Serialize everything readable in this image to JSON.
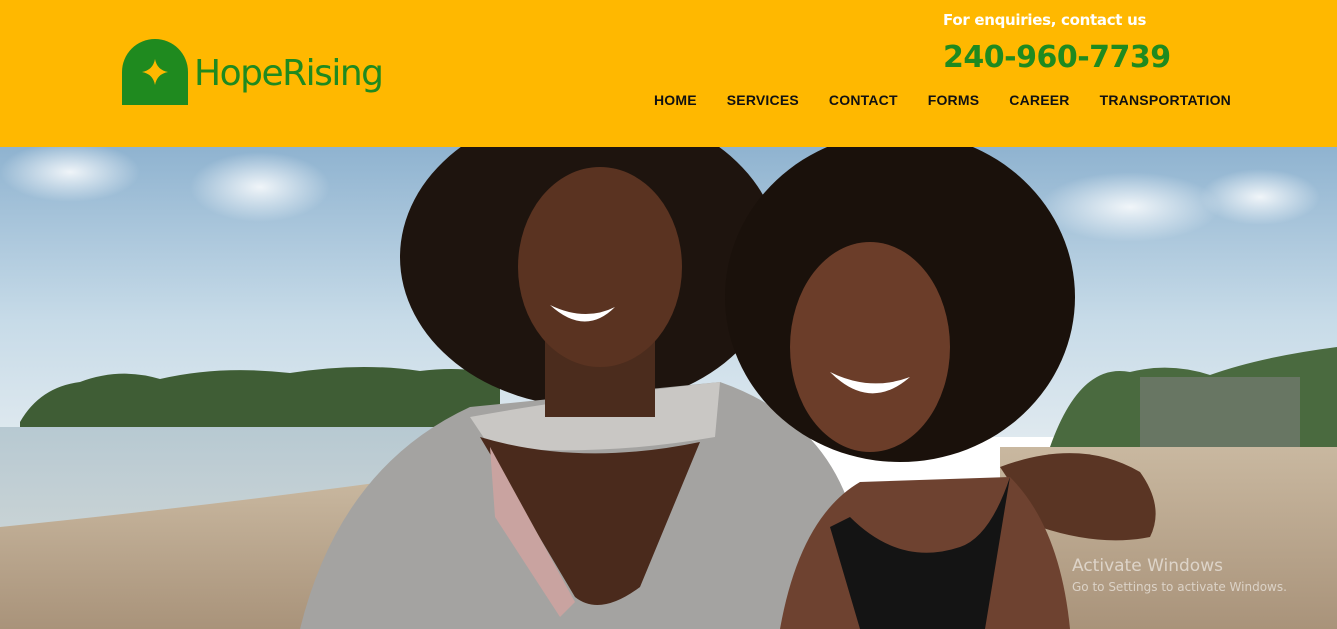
{
  "brand": {
    "name": "HopeRising",
    "color": "#1f8a1f",
    "header_bg": "#ffb800"
  },
  "contact": {
    "enquiry_label": "For enquiries, contact us",
    "phone": "240-960-7739"
  },
  "nav": {
    "items": [
      {
        "label": "HOME"
      },
      {
        "label": "SERVICES"
      },
      {
        "label": "CONTACT"
      },
      {
        "label": "FORMS"
      },
      {
        "label": "CAREER"
      },
      {
        "label": "TRANSPORTATION"
      }
    ]
  },
  "hero": {
    "image": "two-smiling-women-on-beach"
  },
  "watermark": {
    "title": "Activate Windows",
    "subtitle": "Go to Settings to activate Windows."
  }
}
